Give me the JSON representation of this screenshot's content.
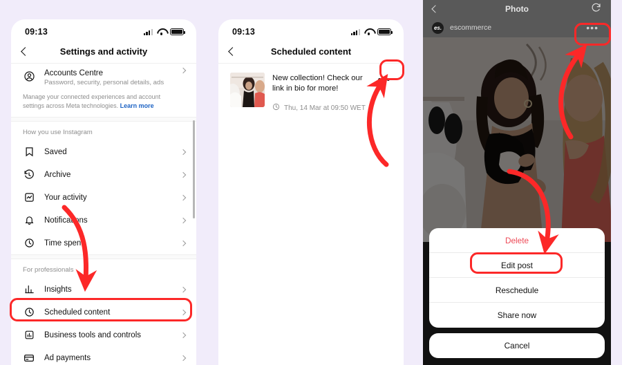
{
  "background_color": "#f1ecfa",
  "accent_color": "#fc2828",
  "panel1": {
    "status_bar": {
      "time": "09:13",
      "icons": [
        "signal-icon",
        "wifi-icon",
        "battery-icon"
      ]
    },
    "nav": {
      "back_icon": "chevron-left-icon",
      "title": "Settings and activity"
    },
    "accounts_centre": {
      "icon": "account-circle-icon",
      "title": "Accounts Centre",
      "subtitle": "Password, security, personal details, ads",
      "chevron": "chevron-right-icon"
    },
    "note": {
      "text": "Manage your connected experiences and account settings across Meta technologies. ",
      "link": "Learn more"
    },
    "group1": {
      "header": "How you use Instagram",
      "items": [
        {
          "label": "Saved",
          "icon": "bookmark-icon"
        },
        {
          "label": "Archive",
          "icon": "archive-clock-icon"
        },
        {
          "label": "Your activity",
          "icon": "activity-chart-icon"
        },
        {
          "label": "Notifications",
          "icon": "bell-icon"
        },
        {
          "label": "Time spent",
          "icon": "clock-icon"
        }
      ]
    },
    "group2": {
      "header": "For professionals",
      "items": [
        {
          "label": "Insights",
          "icon": "bar-chart-icon"
        },
        {
          "label": "Scheduled content",
          "icon": "clock-icon"
        },
        {
          "label": "Business tools and controls",
          "icon": "chart-box-icon"
        },
        {
          "label": "Ad payments",
          "icon": "credit-card-icon"
        }
      ]
    },
    "highlighted_item": "Scheduled content"
  },
  "panel2": {
    "status_bar": {
      "time": "09:13"
    },
    "nav": {
      "back_icon": "chevron-left-icon",
      "title": "Scheduled content"
    },
    "post": {
      "thumbnail": "post-thumbnail",
      "caption": "New collection! Check our link in bio for more!",
      "schedule_icon": "clock-icon",
      "schedule_time": "Thu, 14 Mar at 09:50 WET",
      "more_button": "•••"
    }
  },
  "panel3": {
    "nav": {
      "back_icon": "chevron-left-icon",
      "title": "Photo",
      "refresh_icon": "revert-icon"
    },
    "user": {
      "avatar_text": "es.",
      "username": "escommerce",
      "more_button": "•••"
    },
    "action_sheet": {
      "items": [
        {
          "label": "Delete",
          "style": "danger"
        },
        {
          "label": "Edit post",
          "style": "normal"
        },
        {
          "label": "Reschedule",
          "style": "normal"
        },
        {
          "label": "Share now",
          "style": "normal"
        }
      ],
      "cancel": "Cancel",
      "highlighted_item": "Edit post"
    }
  }
}
